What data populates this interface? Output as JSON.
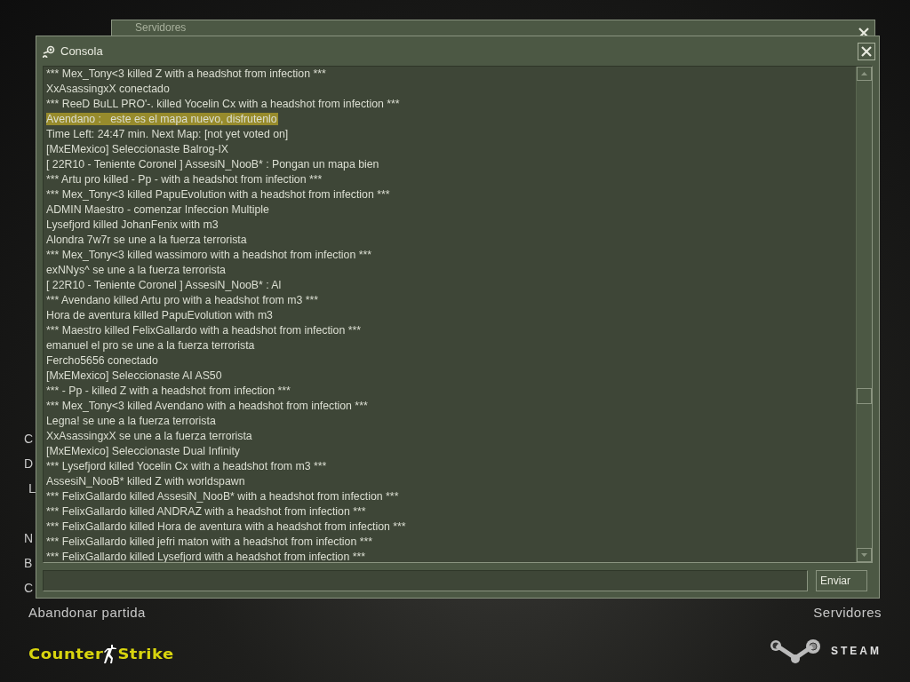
{
  "background_window": {
    "title": "Servidores"
  },
  "menu": {
    "groups": [
      [
        "C",
        "D",
        "L"
      ],
      [
        "N",
        "B",
        "C",
        "Abandonar partida"
      ]
    ]
  },
  "footer": {
    "logo": {
      "left": "Counter",
      "right": "Strike"
    },
    "servers_link": "Servidores",
    "steam_label": "STEAM"
  },
  "console": {
    "title": "Consola",
    "lines": [
      {
        "text": "*** Mex_Tony<3 killed Z with a headshot from infection ***",
        "highlighted": false
      },
      {
        "text": "XxAsassingxX conectado",
        "highlighted": false
      },
      {
        "text": "*** ReeD BuLL PRO'-. killed Yocelin Cx with a headshot from infection ***",
        "highlighted": false
      },
      {
        "text": "Avendano :   este es el mapa nuevo, disfrutenlo",
        "highlighted": true
      },
      {
        "text": "Time Left: 24:47 min. Next Map: [not yet voted on]",
        "highlighted": false
      },
      {
        "text": "[MxEMexico] Seleccionaste Balrog-IX",
        "highlighted": false
      },
      {
        "text": "[ 22R10 - Teniente Coronel ] AssesiN_NooB* : Pongan un mapa bien",
        "highlighted": false
      },
      {
        "text": "*** Artu pro killed - Pp - with a headshot from infection ***",
        "highlighted": false
      },
      {
        "text": "*** Mex_Tony<3 killed PapuEvolution with a headshot from infection ***",
        "highlighted": false
      },
      {
        "text": "ADMIN Maestro - comenzar Infeccion Multiple",
        "highlighted": false
      },
      {
        "text": "Lysefjord killed JohanFenix with m3",
        "highlighted": false
      },
      {
        "text": "Alondra 7w7r se une a la fuerza terrorista",
        "highlighted": false
      },
      {
        "text": "*** Mex_Tony<3 killed wassimoro with a headshot from infection ***",
        "highlighted": false
      },
      {
        "text": "exNNys^ se une a la fuerza terrorista",
        "highlighted": false
      },
      {
        "text": "[ 22R10 - Teniente Coronel ] AssesiN_NooB* : Al",
        "highlighted": false
      },
      {
        "text": "*** Avendano killed Artu pro with a headshot from m3 ***",
        "highlighted": false
      },
      {
        "text": "Hora de aventura killed PapuEvolution with m3",
        "highlighted": false
      },
      {
        "text": "*** Maestro killed FelixGallardo with a headshot from infection ***",
        "highlighted": false
      },
      {
        "text": "emanuel el pro se une a la fuerza terrorista",
        "highlighted": false
      },
      {
        "text": "Fercho5656 conectado",
        "highlighted": false
      },
      {
        "text": "[MxEMexico] Seleccionaste AI AS50",
        "highlighted": false
      },
      {
        "text": "*** - Pp - killed Z with a headshot from infection ***",
        "highlighted": false
      },
      {
        "text": "*** Mex_Tony<3 killed Avendano with a headshot from infection ***",
        "highlighted": false
      },
      {
        "text": "Legna! se une a la fuerza terrorista",
        "highlighted": false
      },
      {
        "text": "XxAsassingxX se une a la fuerza terrorista",
        "highlighted": false
      },
      {
        "text": "[MxEMexico] Seleccionaste Dual Infinity",
        "highlighted": false
      },
      {
        "text": "*** Lysefjord killed Yocelin Cx with a headshot from m3 ***",
        "highlighted": false
      },
      {
        "text": "AssesiN_NooB* killed Z with worldspawn",
        "highlighted": false
      },
      {
        "text": "*** FelixGallardo killed AssesiN_NooB* with a headshot from infection ***",
        "highlighted": false
      },
      {
        "text": "*** FelixGallardo killed ANDRAZ with a headshot from infection ***",
        "highlighted": false
      },
      {
        "text": "*** FelixGallardo killed Hora de aventura with a headshot from infection ***",
        "highlighted": false
      },
      {
        "text": "*** FelixGallardo killed jefri maton with a headshot from infection ***",
        "highlighted": false
      },
      {
        "text": "*** FelixGallardo killed Lysefjord with a headshot from infection ***",
        "highlighted": false
      }
    ],
    "send_button": "Enviar"
  }
}
